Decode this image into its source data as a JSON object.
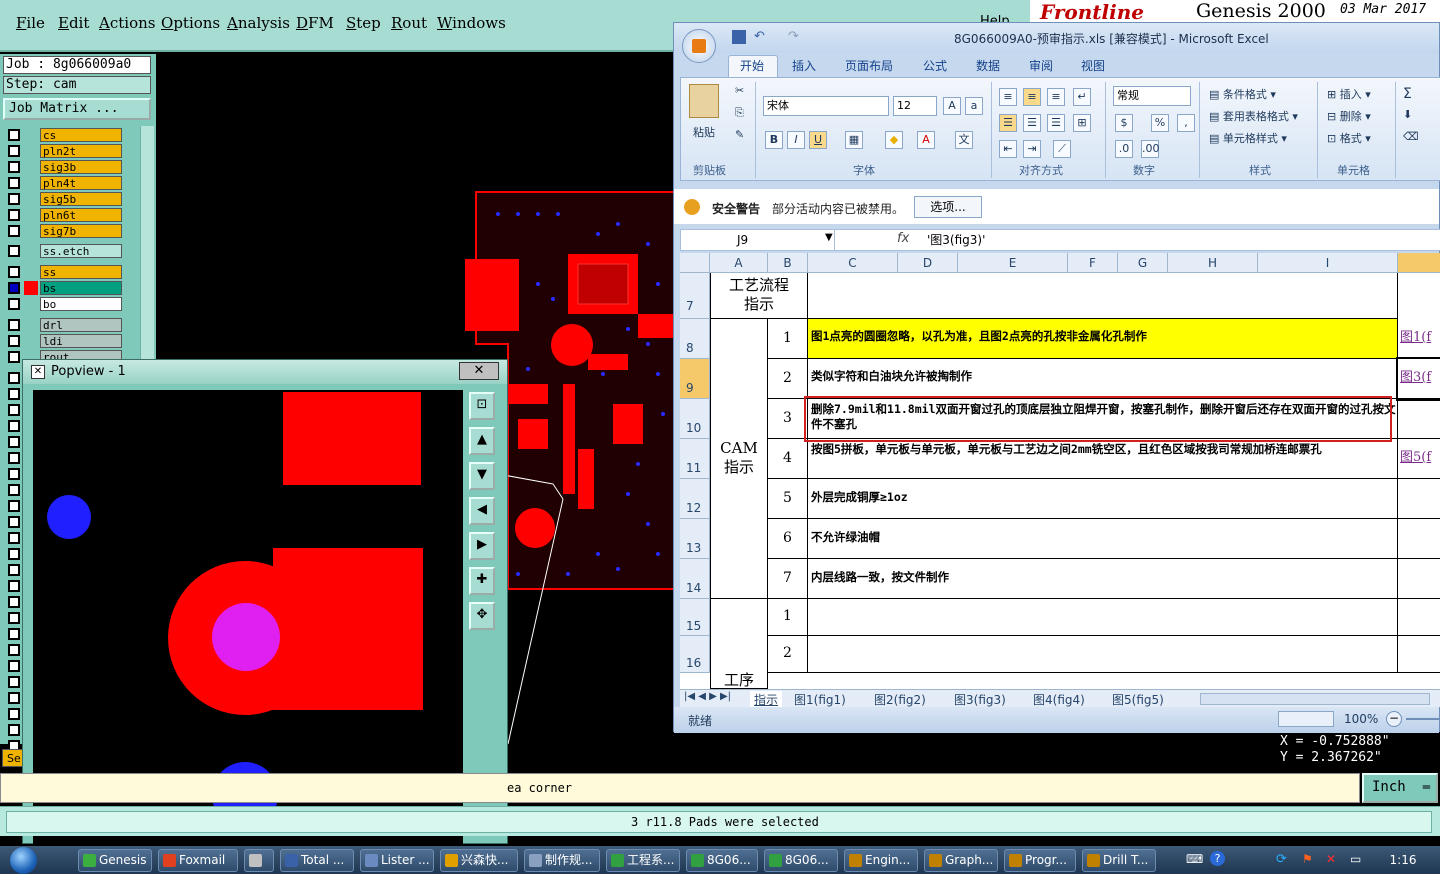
{
  "genesis": {
    "menu": [
      "File",
      "Edit",
      "Actions",
      "Options",
      "Analysis",
      "DFM",
      "Step",
      "Rout",
      "Windows"
    ],
    "job_label": "Job : 8g066009a0",
    "step_label": "Step: cam",
    "job_matrix_button": "Job Matrix ...",
    "layers": [
      {
        "name": "cs",
        "color": "#f0b400"
      },
      {
        "name": "pln2t",
        "color": "#f0b400"
      },
      {
        "name": "sig3b",
        "color": "#f0b400"
      },
      {
        "name": "pln4t",
        "color": "#f0b400"
      },
      {
        "name": "sig5b",
        "color": "#f0b400"
      },
      {
        "name": "pln6t",
        "color": "#f0b400"
      },
      {
        "name": "sig7b",
        "color": "#f0b400"
      },
      {
        "name": "ss.etch",
        "color": "#b7e4da"
      },
      {
        "name": "ss",
        "color": "#f0b400"
      },
      {
        "name": "bs",
        "color": "#00a080"
      },
      {
        "name": "bo",
        "color": "#ffffff"
      },
      {
        "name": "drl",
        "color": "#b0c4c0"
      },
      {
        "name": "ldi",
        "color": "#b0c4c0"
      },
      {
        "name": "rout",
        "color": "#b0c4c0"
      }
    ],
    "left_bottom_label": "Se",
    "popview_title": "Popview - 1",
    "popview_close": "✕",
    "top_right_brand": "Frontline",
    "top_right_title": "Genesis 2000",
    "top_right_date": "03 Mar 2017",
    "top_right_hint": "Help",
    "coord_x": "X = -0.752888\"",
    "coord_y": "Y = 2.367262\"",
    "message": "ea corner",
    "unit_button": "Inch",
    "status_text": "3 r11.8 Pads were selected"
  },
  "excel": {
    "title": "8G066009A0-预审指示.xls  [兼容模式] - Microsoft Excel",
    "ribbon_tabs": [
      "开始",
      "插入",
      "页面布局",
      "公式",
      "数据",
      "审阅",
      "视图"
    ],
    "active_tab": "开始",
    "clipboard_group": "剪贴板",
    "paste_label": "粘贴",
    "font_group": "字体",
    "font_name": "宋体",
    "font_size": "12",
    "align_group": "对齐方式",
    "number_group": "数字",
    "number_format": "常规",
    "style_group": "样式",
    "style_buttons": [
      "条件格式",
      "套用表格格式",
      "单元格样式"
    ],
    "cells_group": "单元格",
    "cells_buttons": [
      "插入",
      "删除",
      "格式"
    ],
    "security_title": "安全警告",
    "security_text": "部分活动内容已被禁用。",
    "security_button": "选项...",
    "name_box": "J9",
    "formula": "'图3(fig3)'",
    "columns": [
      "A",
      "B",
      "C",
      "D",
      "E",
      "F",
      "G",
      "H",
      "I"
    ],
    "row_numbers": [
      "7",
      "8",
      "9",
      "10",
      "11",
      "12",
      "13",
      "14",
      "15",
      "16"
    ],
    "header_cell": "工艺流程\n指示",
    "group_label": "CAM\n指示",
    "bottom_label": "工序",
    "rows": [
      {
        "no": "1",
        "text": "图1点亮的圆圈忽略，以孔为准，且图2点亮的孔按非金属化孔制作",
        "link": "图1(f"
      },
      {
        "no": "2",
        "text": "类似字符和白油块允许被掏制作",
        "link": "图3(f"
      },
      {
        "no": "3",
        "text": "删除7.9mil和11.8mil双面开窗过孔的顶底层独立阻焊开窗，按塞孔制作，删除开窗后还存在双面开窗的过孔按文件不塞孔",
        "link": ""
      },
      {
        "no": "4",
        "text": "按图5拼板，单元板与单元板，单元板与工艺边之间2mm铣空区，且红色区域按我司常规加桥连邮票孔",
        "link": "图5(f"
      },
      {
        "no": "5",
        "text": "外层完成铜厚≥1oz",
        "link": ""
      },
      {
        "no": "6",
        "text": "不允许绿油帽",
        "link": ""
      },
      {
        "no": "7",
        "text": "内层线路一致，按文件制作",
        "link": ""
      },
      {
        "no": "1",
        "text": "",
        "link": ""
      },
      {
        "no": "2",
        "text": "",
        "link": ""
      }
    ],
    "sheet_tabs": [
      "指示",
      "图1(fig1)",
      "图2(fig2)",
      "图3(fig3)",
      "图4(fig4)",
      "图5(fig5)"
    ],
    "status_ready": "就绪",
    "zoom": "100%"
  },
  "taskbar": {
    "items": [
      "Genesis",
      "Foxmail",
      "",
      "Total ...",
      "Lister ...",
      "兴森快...",
      "制作规...",
      "工程系...",
      "8G06...",
      "8G06...",
      "Engin...",
      "Graph...",
      "Progr...",
      "Drill T..."
    ],
    "clock": "1:16"
  }
}
